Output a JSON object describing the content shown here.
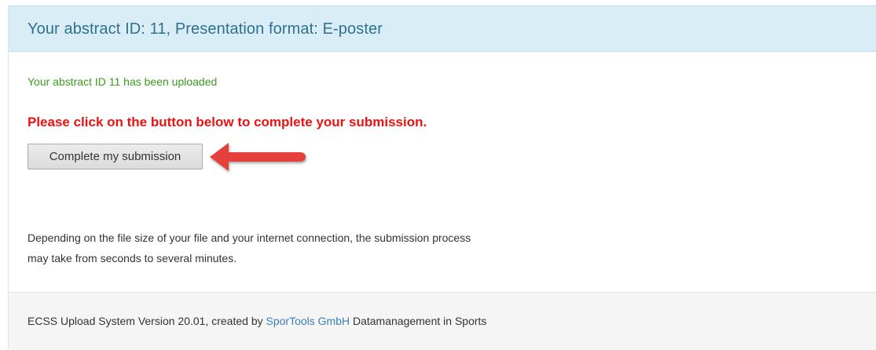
{
  "panel": {
    "title": "Your abstract ID: 11, Presentation format: E-poster"
  },
  "messages": {
    "success": "Your abstract ID 11 has been uploaded",
    "alert": "Please click on the button below to complete your submission."
  },
  "actions": {
    "complete_label": "Complete my submission"
  },
  "info": {
    "line1": "Depending on the file size of your file and your internet connection, the submission process",
    "line2": "may take from seconds to several minutes."
  },
  "footer": {
    "prefix": "ECSS Upload System Version 20.01, created by ",
    "link": "SporTools GmbH",
    "suffix": " Datamanagement in Sports"
  },
  "colors": {
    "heading_bg": "#d9edf7",
    "heading_text": "#31708f",
    "success_text": "#3c9a1e",
    "alert_text": "#ee1111",
    "arrow": "#e5413a",
    "link": "#3b7fb6",
    "footer_bg": "#f5f5f5"
  },
  "icons": {
    "pointer": "arrow-left-icon"
  }
}
